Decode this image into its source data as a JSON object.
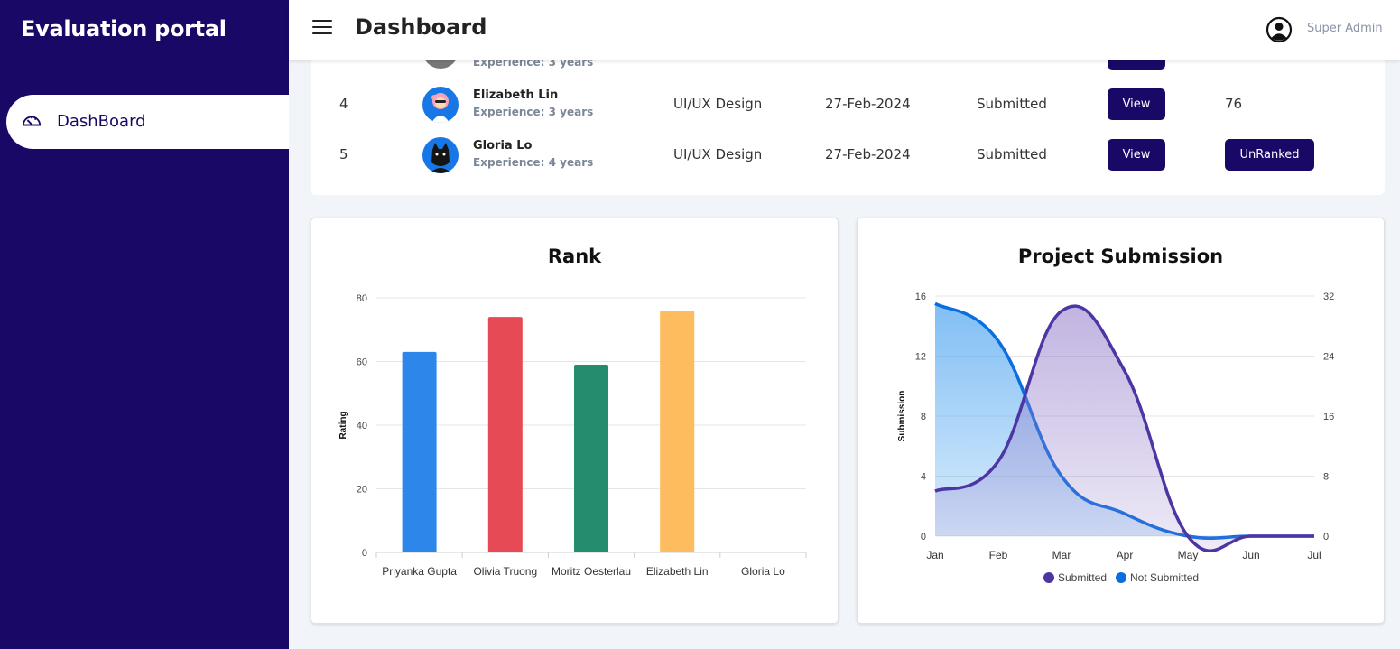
{
  "sidebar": {
    "brand": "Evaluation portal",
    "nav": [
      {
        "label": "DashBoard",
        "icon": "dashboard-gauge-icon"
      }
    ]
  },
  "header": {
    "title": "Dashboard",
    "menu_icon": "hamburger-menu-icon",
    "user_icon": "user-circle-icon",
    "user_name": "Super Admin"
  },
  "table": {
    "partial_row": {
      "experience": "Experience: 3 years"
    },
    "rows": [
      {
        "index": "4",
        "name": "Elizabeth Lin",
        "experience": "Experience: 3 years",
        "role": "UI/UX Design",
        "date": "27-Feb-2024",
        "status": "Submitted",
        "action": "View",
        "rank": "76"
      },
      {
        "index": "5",
        "name": "Gloria Lo",
        "experience": "Experience: 4 years",
        "role": "UI/UX Design",
        "date": "27-Feb-2024",
        "status": "Submitted",
        "action": "View",
        "rank": "UnRanked"
      }
    ]
  },
  "colors": {
    "sidebar": "#1a0867",
    "primary": "#1a0867",
    "submitted": "#4d35a3",
    "not_submitted": "#0b6ee0"
  },
  "chart_data": [
    {
      "type": "bar",
      "title": "Rank",
      "xlabel": "",
      "ylabel": "Rating",
      "categories": [
        "Priyanka Gupta",
        "Olivia Truong",
        "Moritz Oesterlau",
        "Elizabeth Lin",
        "Gloria Lo"
      ],
      "values": [
        63,
        74,
        59,
        76,
        0
      ],
      "colors": [
        "#2d87ea",
        "#e64a55",
        "#238d6e",
        "#fdbd5e",
        "#cccccc"
      ],
      "ylim": [
        0,
        80
      ],
      "yticks": [
        "0",
        "20",
        "40",
        "60",
        "80"
      ],
      "grid": true
    },
    {
      "type": "area",
      "title": "Project Submission",
      "ylabel": "Submission",
      "x": [
        "Jan",
        "Feb",
        "Mar",
        "Apr",
        "May",
        "Jun",
        "Jul"
      ],
      "series": [
        {
          "name": "Submitted",
          "axis": "left",
          "values": [
            3,
            5,
            15,
            11,
            0,
            0,
            0
          ]
        },
        {
          "name": "Not Submitted",
          "axis": "right",
          "values": [
            31,
            26,
            8,
            3,
            0,
            0,
            0
          ]
        }
      ],
      "ylim_left": [
        0,
        16
      ],
      "ylim_right": [
        0,
        32
      ],
      "yticks_left": [
        "0",
        "4",
        "8",
        "12",
        "16"
      ],
      "yticks_right": [
        "0",
        "8",
        "16",
        "24",
        "32"
      ],
      "legend_position": "bottom",
      "grid": true
    }
  ]
}
